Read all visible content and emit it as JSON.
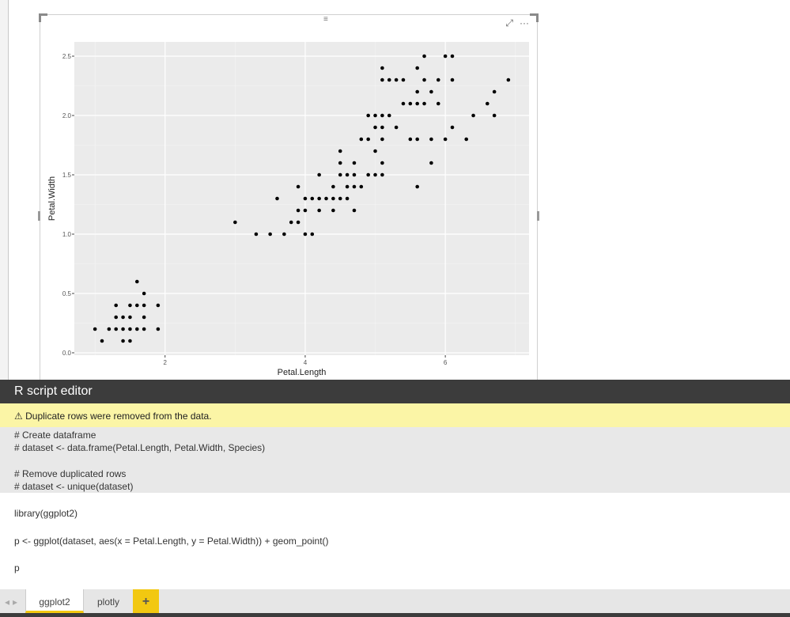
{
  "visual": {
    "focus_icon": "focus-mode-icon",
    "more_icon": "ellipsis-icon",
    "more_label": "···"
  },
  "chart_data": {
    "type": "scatter",
    "xlabel": "Petal.Length",
    "ylabel": "Petal.Width",
    "xlim": [
      0.705,
      7.195
    ],
    "ylim": [
      -0.02,
      2.62
    ],
    "xticks": [
      2,
      4,
      6
    ],
    "yticks": [
      "0.0",
      "0.5",
      "1.0",
      "1.5",
      "2.0",
      "2.5"
    ],
    "grid": true,
    "panel_color": "#ebebeb",
    "point_color": "#000000",
    "points": [
      [
        1.0,
        0.2
      ],
      [
        1.2,
        0.2
      ],
      [
        1.3,
        0.2
      ],
      [
        1.4,
        0.2
      ],
      [
        1.5,
        0.2
      ],
      [
        1.6,
        0.2
      ],
      [
        1.7,
        0.2
      ],
      [
        1.9,
        0.2
      ],
      [
        1.1,
        0.1
      ],
      [
        1.4,
        0.1
      ],
      [
        1.5,
        0.1
      ],
      [
        1.3,
        0.3
      ],
      [
        1.4,
        0.3
      ],
      [
        1.5,
        0.3
      ],
      [
        1.7,
        0.3
      ],
      [
        1.3,
        0.4
      ],
      [
        1.5,
        0.4
      ],
      [
        1.6,
        0.4
      ],
      [
        1.7,
        0.4
      ],
      [
        1.9,
        0.4
      ],
      [
        1.7,
        0.5
      ],
      [
        1.6,
        0.6
      ],
      [
        3.3,
        1.0
      ],
      [
        3.5,
        1.0
      ],
      [
        3.7,
        1.0
      ],
      [
        4.0,
        1.0
      ],
      [
        4.1,
        1.0
      ],
      [
        3.0,
        1.1
      ],
      [
        3.8,
        1.1
      ],
      [
        3.9,
        1.1
      ],
      [
        3.9,
        1.2
      ],
      [
        4.0,
        1.2
      ],
      [
        4.2,
        1.2
      ],
      [
        4.4,
        1.2
      ],
      [
        4.7,
        1.2
      ],
      [
        3.6,
        1.3
      ],
      [
        4.0,
        1.3
      ],
      [
        4.1,
        1.3
      ],
      [
        4.2,
        1.3
      ],
      [
        4.3,
        1.3
      ],
      [
        4.4,
        1.3
      ],
      [
        4.5,
        1.3
      ],
      [
        4.6,
        1.3
      ],
      [
        3.9,
        1.4
      ],
      [
        4.4,
        1.4
      ],
      [
        4.6,
        1.4
      ],
      [
        4.7,
        1.4
      ],
      [
        4.8,
        1.4
      ],
      [
        5.6,
        1.4
      ],
      [
        4.2,
        1.5
      ],
      [
        4.5,
        1.5
      ],
      [
        4.6,
        1.5
      ],
      [
        4.7,
        1.5
      ],
      [
        4.9,
        1.5
      ],
      [
        5.0,
        1.5
      ],
      [
        5.1,
        1.5
      ],
      [
        4.5,
        1.6
      ],
      [
        4.7,
        1.6
      ],
      [
        5.1,
        1.6
      ],
      [
        5.8,
        1.6
      ],
      [
        4.5,
        1.7
      ],
      [
        5.0,
        1.7
      ],
      [
        4.8,
        1.8
      ],
      [
        4.9,
        1.8
      ],
      [
        5.1,
        1.8
      ],
      [
        5.5,
        1.8
      ],
      [
        5.6,
        1.8
      ],
      [
        5.8,
        1.8
      ],
      [
        6.0,
        1.8
      ],
      [
        6.3,
        1.8
      ],
      [
        5.0,
        1.9
      ],
      [
        5.1,
        1.9
      ],
      [
        5.3,
        1.9
      ],
      [
        6.1,
        1.9
      ],
      [
        4.9,
        2.0
      ],
      [
        5.0,
        2.0
      ],
      [
        5.1,
        2.0
      ],
      [
        5.2,
        2.0
      ],
      [
        6.4,
        2.0
      ],
      [
        6.7,
        2.0
      ],
      [
        5.4,
        2.1
      ],
      [
        5.5,
        2.1
      ],
      [
        5.6,
        2.1
      ],
      [
        5.7,
        2.1
      ],
      [
        5.9,
        2.1
      ],
      [
        6.6,
        2.1
      ],
      [
        5.6,
        2.2
      ],
      [
        5.8,
        2.2
      ],
      [
        6.7,
        2.2
      ],
      [
        5.1,
        2.3
      ],
      [
        5.2,
        2.3
      ],
      [
        5.3,
        2.3
      ],
      [
        5.4,
        2.3
      ],
      [
        5.7,
        2.3
      ],
      [
        5.9,
        2.3
      ],
      [
        6.1,
        2.3
      ],
      [
        6.9,
        2.3
      ],
      [
        5.1,
        2.4
      ],
      [
        5.6,
        2.4
      ],
      [
        5.7,
        2.5
      ],
      [
        6.0,
        2.5
      ],
      [
        6.1,
        2.5
      ]
    ]
  },
  "editor": {
    "title": "R script editor",
    "warning_icon": "warning-triangle-icon",
    "warning": "Duplicate rows were removed from the data.",
    "header_lines": [
      "# Create dataframe",
      "# dataset <- data.frame(Petal.Length, Petal.Width, Species)",
      "",
      "# Remove duplicated rows",
      "# dataset <- unique(dataset)"
    ],
    "code_lines": [
      "library(ggplot2)",
      "p <- ggplot(dataset, aes(x = Petal.Length, y = Petal.Width)) + geom_point()",
      "p"
    ]
  },
  "tabs": {
    "items": [
      {
        "label": "ggplot2",
        "active": true
      },
      {
        "label": "plotly",
        "active": false
      }
    ],
    "add_label": "+",
    "accent": "#f2c811"
  }
}
